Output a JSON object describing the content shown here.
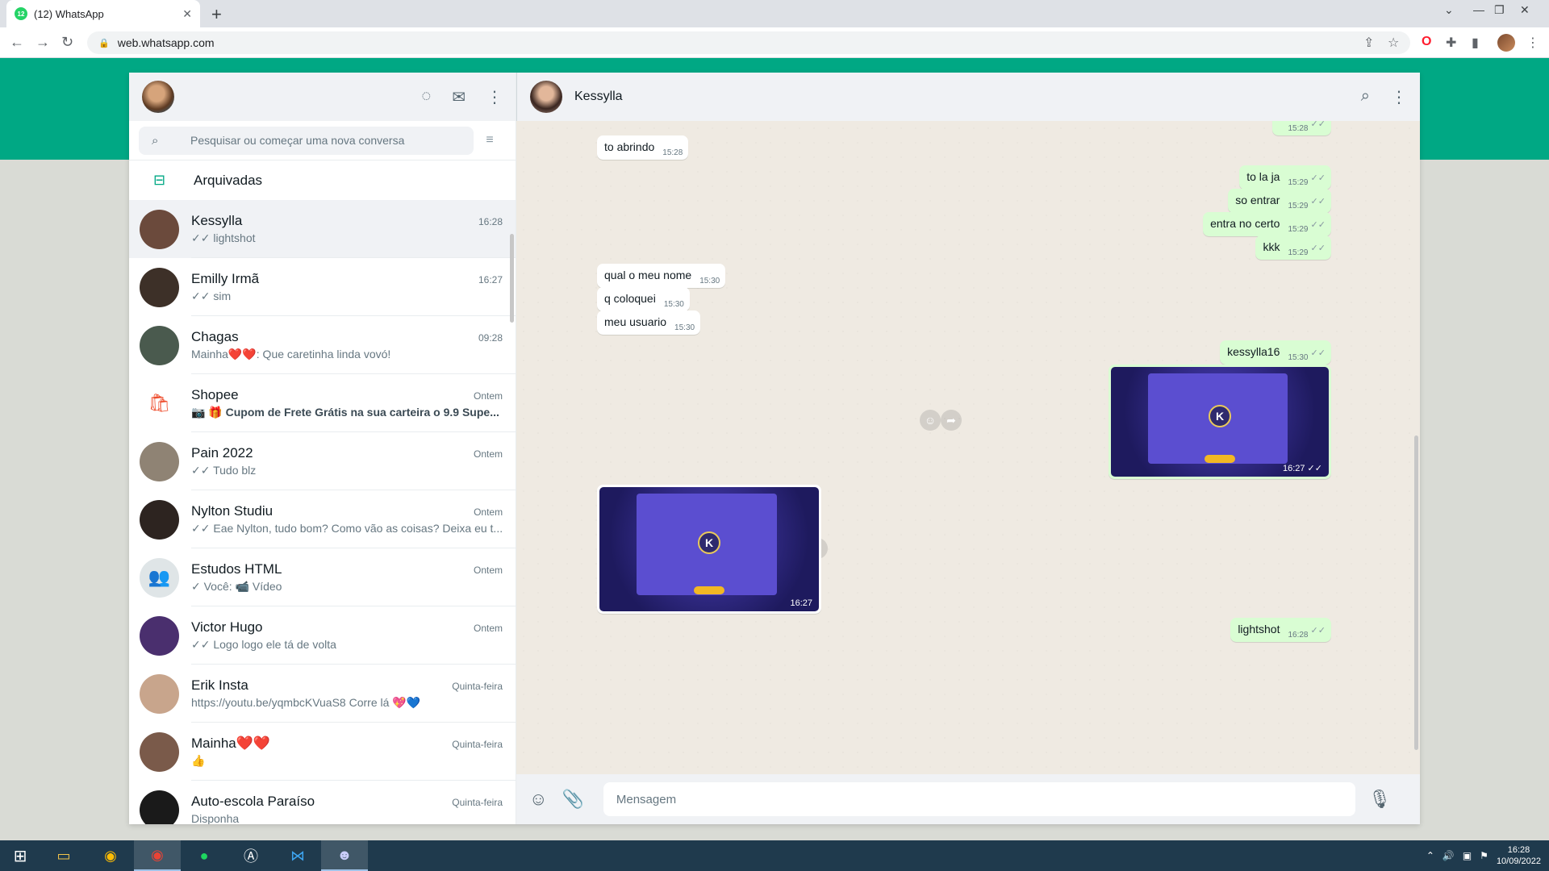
{
  "browser": {
    "tab_title": "(12) WhatsApp",
    "tab_badge": "12",
    "url": "web.whatsapp.com"
  },
  "sidebar": {
    "search_placeholder": "Pesquisar ou começar uma nova conversa",
    "archived_label": "Arquivadas",
    "chats": [
      {
        "name": "Kessylla",
        "time": "16:28",
        "preview": "✓✓ lightshot",
        "avatar_color": "#6b4a3c",
        "active": true
      },
      {
        "name": "Emilly Irmã",
        "time": "16:27",
        "preview": "✓✓ sim",
        "avatar_color": "#3d3028"
      },
      {
        "name": "Chagas",
        "time": "09:28",
        "preview": "Mainha❤️❤️: Que caretinha linda vovó!",
        "avatar_color": "#4a5a4e"
      },
      {
        "name": "Shopee",
        "time": "Ontem",
        "preview": "📷 🎁 Cupom de Frete Grátis na sua carteira o 9.9 Supe...",
        "avatar_color": "#ffffff",
        "bold": true
      },
      {
        "name": "Pain 2022",
        "time": "Ontem",
        "preview": "✓✓ Tudo blz",
        "avatar_color": "#8f8374"
      },
      {
        "name": "Nylton Studiu",
        "time": "Ontem",
        "preview": "✓✓ Eae Nylton, tudo bom? Como vão as coisas?  Deixa eu t...",
        "avatar_color": "#2d2420"
      },
      {
        "name": "Estudos HTML",
        "time": "Ontem",
        "preview": "✓ Você: 📹 Vídeo",
        "avatar_color": "#dfe5e7"
      },
      {
        "name": "Victor Hugo",
        "time": "Ontem",
        "preview": "✓✓ Logo logo ele tá de volta",
        "avatar_color": "#4a2f6e"
      },
      {
        "name": "Erik Insta",
        "time": "Quinta-feira",
        "preview": "https://youtu.be/yqmbcKVuaS8 Corre lá 💖💙",
        "avatar_color": "#c8a58c"
      },
      {
        "name": "Mainha❤️❤️",
        "time": "Quinta-feira",
        "preview": "👍",
        "avatar_color": "#7a5a4a"
      },
      {
        "name": "Auto-escola Paraíso",
        "time": "Quinta-feira",
        "preview": "Disponha",
        "avatar_color": "#1a1a1a"
      }
    ]
  },
  "conversation": {
    "contact_name": "Kessylla",
    "input_placeholder": "Mensagem",
    "messages": [
      {
        "dir": "out",
        "text": "",
        "time": "15:28",
        "partial": true
      },
      {
        "dir": "in",
        "text": "to abrindo",
        "time": "15:28"
      },
      {
        "dir": "out",
        "text": "to la ja",
        "time": "15:29"
      },
      {
        "dir": "out",
        "text": "so entrar",
        "time": "15:29"
      },
      {
        "dir": "out",
        "text": "entra no certo",
        "time": "15:29"
      },
      {
        "dir": "out",
        "text": "kkk",
        "time": "15:29"
      },
      {
        "dir": "in",
        "text": "qual o meu nome",
        "time": "15:30"
      },
      {
        "dir": "in",
        "text": "q coloquei",
        "time": "15:30"
      },
      {
        "dir": "in",
        "text": "meu usuario",
        "time": "15:30"
      },
      {
        "dir": "out",
        "text": "kessylla16",
        "time": "15:30"
      },
      {
        "dir": "out",
        "type": "image",
        "time": "16:27",
        "badge": "K"
      },
      {
        "dir": "in",
        "type": "image",
        "time": "16:27",
        "badge": "K"
      },
      {
        "dir": "out",
        "text": "lightshot",
        "time": "16:28"
      }
    ]
  },
  "taskbar": {
    "time": "16:28",
    "date": "10/09/2022"
  }
}
